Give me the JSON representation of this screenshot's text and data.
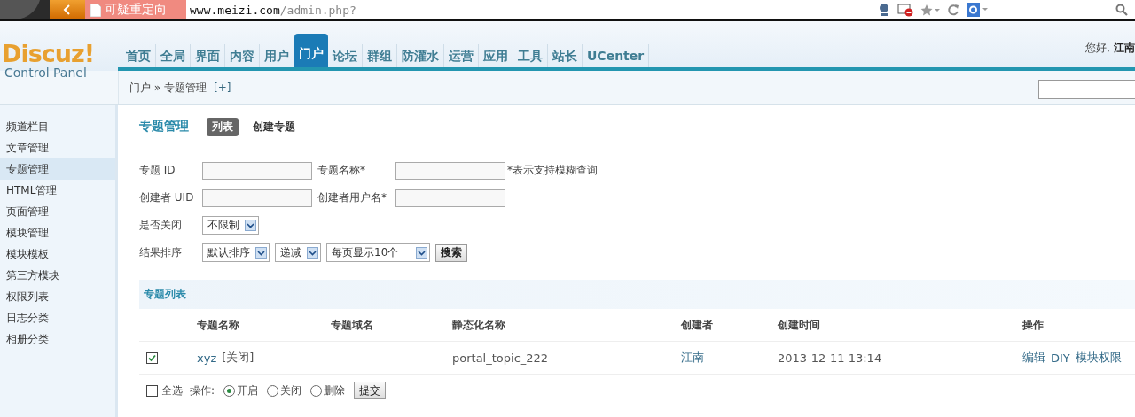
{
  "browser": {
    "warning": "可疑重定向",
    "url_host": "www.meizi.com",
    "url_path": "/admin.php?"
  },
  "header": {
    "logo": "Discuz!",
    "subtitle": "Control Panel",
    "greeting": "您好,",
    "user": "江南",
    "nav": [
      {
        "label": "首页",
        "selected": false
      },
      {
        "label": "全局",
        "selected": false
      },
      {
        "label": "界面",
        "selected": false
      },
      {
        "label": "内容",
        "selected": false
      },
      {
        "label": "用户",
        "selected": false
      },
      {
        "label": "门户",
        "selected": true
      },
      {
        "label": "论坛",
        "selected": false
      },
      {
        "label": "群组",
        "selected": false
      },
      {
        "label": "防灌水",
        "selected": false
      },
      {
        "label": "运营",
        "selected": false
      },
      {
        "label": "应用",
        "selected": false
      },
      {
        "label": "工具",
        "selected": false
      },
      {
        "label": "站长",
        "selected": false
      },
      {
        "label": "UCenter",
        "selected": false
      }
    ]
  },
  "breadcrumb": {
    "path": "门户 » 专题管理",
    "add": "[+]"
  },
  "sidebar": {
    "items": [
      {
        "label": "频道栏目",
        "selected": false
      },
      {
        "label": "文章管理",
        "selected": false
      },
      {
        "label": "专题管理",
        "selected": true
      },
      {
        "label": "HTML管理",
        "selected": false
      },
      {
        "label": "页面管理",
        "selected": false
      },
      {
        "label": "模块管理",
        "selected": false
      },
      {
        "label": "模块模板",
        "selected": false
      },
      {
        "label": "第三方模块",
        "selected": false
      },
      {
        "label": "权限列表",
        "selected": false
      },
      {
        "label": "日志分类",
        "selected": false
      },
      {
        "label": "相册分类",
        "selected": false
      }
    ]
  },
  "page": {
    "title": "专题管理",
    "tabs": [
      {
        "label": "列表",
        "selected": true
      },
      {
        "label": "创建专题",
        "selected": false
      }
    ]
  },
  "filters": [
    [
      {
        "kind": "label",
        "text": "专题 ID"
      },
      {
        "kind": "input"
      },
      {
        "kind": "label",
        "text": "专题名称*"
      },
      {
        "kind": "input"
      },
      {
        "kind": "hint",
        "text": "*表示支持模糊查询"
      }
    ],
    [
      {
        "kind": "label",
        "text": "创建者 UID"
      },
      {
        "kind": "input"
      },
      {
        "kind": "label",
        "text": "创建者用户名*"
      },
      {
        "kind": "input"
      }
    ],
    [
      {
        "kind": "label",
        "text": "是否关闭"
      },
      {
        "kind": "select",
        "value": "不限制"
      }
    ],
    [
      {
        "kind": "label",
        "text": "结果排序"
      },
      {
        "kind": "select",
        "value": "默认排序"
      },
      {
        "kind": "select",
        "value": "递减"
      },
      {
        "kind": "select",
        "value": "每页显示10个",
        "wide": true
      },
      {
        "kind": "button",
        "text": "搜索"
      }
    ]
  ],
  "list": {
    "title": "专题列表",
    "columns": [
      "专题名称",
      "专题域名",
      "静态化名称",
      "创建者",
      "创建时间",
      "操作"
    ],
    "rows": [
      {
        "checked": true,
        "name": "xyz",
        "status": "[关闭]",
        "static_name": "portal_topic_222",
        "creator": "江南",
        "created": "2013-12-11 13:14",
        "actions": [
          "编辑",
          "DIY",
          "模块权限"
        ]
      }
    ],
    "footer": {
      "select_all": {
        "label": "全选",
        "checked": false
      },
      "action_label": "操作:",
      "options": [
        {
          "label": "开启",
          "selected": true
        },
        {
          "label": "关闭",
          "selected": false
        },
        {
          "label": "删除",
          "selected": false
        }
      ],
      "submit": "提交"
    }
  }
}
